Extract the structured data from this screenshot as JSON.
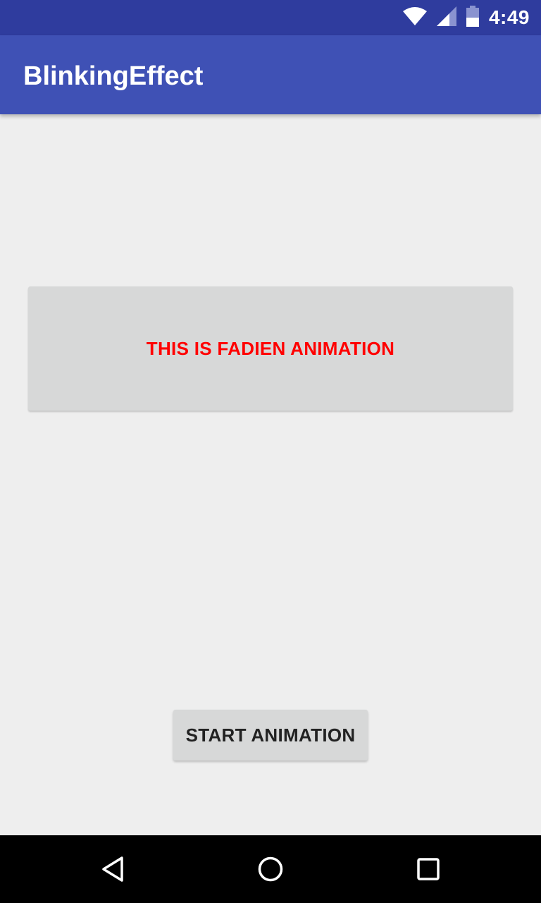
{
  "status_bar": {
    "time": "4:49",
    "icons": [
      "wifi-icon",
      "signal-icon",
      "battery-icon"
    ],
    "background": "#2f3c9e"
  },
  "app_bar": {
    "title": "BlinkingEffect",
    "background": "#3f51b5"
  },
  "main": {
    "fade_text": "THIS IS FADIEN ANIMATION",
    "fade_text_color": "#ff0000",
    "start_button_label": "START ANIMATION"
  },
  "nav_bar": {
    "icons": [
      "back-icon",
      "home-icon",
      "recents-icon"
    ]
  }
}
